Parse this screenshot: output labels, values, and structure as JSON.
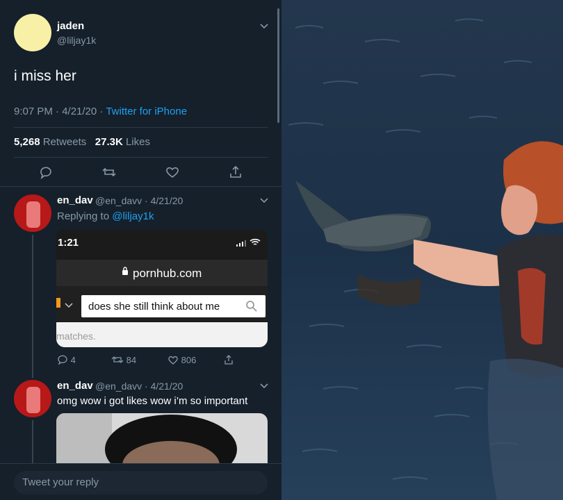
{
  "tweet": {
    "name": "jaden",
    "handle": "@liljay1k",
    "text": "i miss her",
    "time": "9:07 PM · 4/21/20 · ",
    "client": "Twitter for iPhone",
    "retweets_count": "5,268",
    "retweets_label": "Retweets",
    "likes_count": "27.3K",
    "likes_label": "Likes"
  },
  "reply1": {
    "name": "en_dav",
    "handle_date": "@en_davv · 4/21/20",
    "replying_prefix": "Replying to ",
    "replying_to": "@liljay1k",
    "image": {
      "time": "1:21",
      "url": "pornhub.com",
      "search_text": "does she still think about me",
      "matches_text": "matches."
    },
    "replies": "4",
    "retweets": "84",
    "likes": "806"
  },
  "reply2": {
    "name": "en_dav",
    "handle_date": "@en_davv · 4/21/20",
    "text": "omg wow i got likes wow i’m so important"
  },
  "compose": {
    "placeholder": "Tweet your reply"
  },
  "colors": {
    "background": "#15202b",
    "link": "#1da1f2",
    "muted": "#8899a6",
    "water": "#1f3550"
  },
  "icons": [
    "chevron-down-icon",
    "reply-icon",
    "retweet-icon",
    "like-icon",
    "share-icon",
    "lock-icon",
    "search-icon",
    "wifi-icon",
    "signal-icon"
  ]
}
